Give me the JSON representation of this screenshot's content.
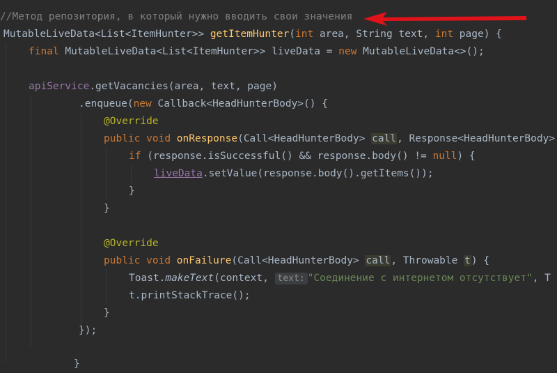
{
  "code": {
    "l1_comment": "//Метод репозитория, в который нужно вводить свои значения",
    "l2": {
      "a": "MutableLiveData<List<ItemHunter>> ",
      "fn": "getItemHunter",
      "b": "(",
      "kw1": "int",
      "c": " area, String text, ",
      "kw2": "int",
      "d": " page) {"
    },
    "l3": {
      "kw1": "final",
      "a": " MutableLiveData<List<ItemHunter>> liveData = ",
      "kw2": "new",
      "b": " MutableLiveData<>();"
    },
    "l5": {
      "field": "apiService",
      "a": ".getVacancies(area, text, page)"
    },
    "l6": {
      "a": ".enqueue(",
      "kw": "new",
      "b": " Callback<HeadHunterBody>() {"
    },
    "l7_ann": "@Override",
    "l8": {
      "kw1": "public",
      "kw2": "void",
      "fn": "onResponse",
      "a": "(Call<HeadHunterBody> ",
      "hl": "call",
      "b": ", Response<HeadHunterBody> r"
    },
    "l9": {
      "kw1": "if",
      "a": " (response.isSuccessful() && response.body() != ",
      "kw2": "null",
      "b": ") {"
    },
    "l10": {
      "field": "liveData",
      "a": ".setValue(response.body().getItems());"
    },
    "l11": "}",
    "l12": "}",
    "l14_ann": "@Override",
    "l15": {
      "kw1": "public",
      "kw2": "void",
      "fn": "onFailure",
      "a": "(Call<HeadHunterBody> ",
      "hl1": "call",
      "b": ", Throwable ",
      "hl2": "t",
      "c": ") {"
    },
    "l16": {
      "a": "Toast.",
      "it": "makeText",
      "b": "(context, ",
      "hint": "text:",
      "str": "\"Соединение с интернетом отсутствует\"",
      "c": ", T"
    },
    "l17": "t.printStackTrace();",
    "l18": "}",
    "l19": "});",
    "l21": "}"
  },
  "colors": {
    "background": "#2b2b2b",
    "keyword": "#cc7832",
    "function": "#ffc66d",
    "comment": "#808080",
    "annotation": "#bbb529",
    "string": "#6a8759",
    "field": "#9876aa",
    "arrow": "#e0131b"
  }
}
